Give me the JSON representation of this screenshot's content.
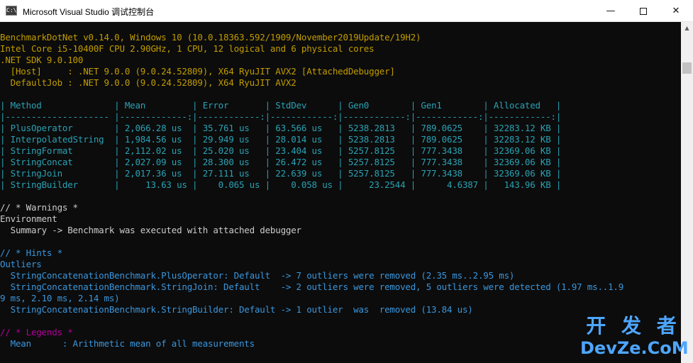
{
  "window": {
    "title": "Microsoft Visual Studio 调试控制台",
    "icon_text": "C:\\",
    "buttons": {
      "minimize": "—",
      "maximize": "",
      "close": "✕"
    }
  },
  "console": {
    "env_lines": [
      "BenchmarkDotNet v0.14.0, Windows 10 (10.0.18363.592/1909/November2019Update/19H2)",
      "Intel Core i5-10400F CPU 2.90GHz, 1 CPU, 12 logical and 6 physical cores",
      ".NET SDK 9.0.100",
      "  [Host]     : .NET 9.0.0 (9.0.24.52809), X64 RyuJIT AVX2 [AttachedDebugger]",
      "  DefaultJob : .NET 9.0.0 (9.0.24.52809), X64 RyuJIT AVX2"
    ],
    "table": {
      "headers": [
        "Method",
        "Mean",
        "Error",
        "StdDev",
        "Gen0",
        "Gen1",
        "Allocated"
      ],
      "header_line": "| Method              | Mean         | Error       | StdDev      | Gen0        | Gen1        | Allocated   |",
      "separator_line": "|-------------------- |-------------:|------------:|------------:|------------:|------------:|------------:|",
      "rows": [
        {
          "method": "PlusOperator",
          "mean": "2,066.28 us",
          "error": "35.761 us",
          "stddev": "63.566 us",
          "gen0": "5238.2813",
          "gen1": "789.0625",
          "allocated": "32283.12 KB"
        },
        {
          "method": "InterpolatedString",
          "mean": "1,984.56 us",
          "error": "29.949 us",
          "stddev": "28.014 us",
          "gen0": "5238.2813",
          "gen1": "789.0625",
          "allocated": "32283.12 KB"
        },
        {
          "method": "StringFormat",
          "mean": "2,112.02 us",
          "error": "25.020 us",
          "stddev": "23.404 us",
          "gen0": "5257.8125",
          "gen1": "777.3438",
          "allocated": "32369.06 KB"
        },
        {
          "method": "StringConcat",
          "mean": "2,027.09 us",
          "error": "28.300 us",
          "stddev": "26.472 us",
          "gen0": "5257.8125",
          "gen1": "777.3438",
          "allocated": "32369.06 KB"
        },
        {
          "method": "StringJoin",
          "mean": "2,017.36 us",
          "error": "27.111 us",
          "stddev": "22.639 us",
          "gen0": "5257.8125",
          "gen1": "777.3438",
          "allocated": "32369.06 KB"
        },
        {
          "method": "StringBuilder",
          "mean": "13.63 us",
          "error": "0.065 us",
          "stddev": "0.058 us",
          "gen0": "23.2544",
          "gen1": "4.6387",
          "allocated": "143.96 KB"
        }
      ],
      "row_lines": [
        "| PlusOperator        | 2,066.28 us  | 35.761 us   | 63.566 us   | 5238.2813   | 789.0625    | 32283.12 KB |",
        "| InterpolatedString  | 1,984.56 us  | 29.949 us   | 28.014 us   | 5238.2813   | 789.0625    | 32283.12 KB |",
        "| StringFormat        | 2,112.02 us  | 25.020 us   | 23.404 us   | 5257.8125   | 777.3438    | 32369.06 KB |",
        "| StringConcat        | 2,027.09 us  | 28.300 us   | 26.472 us   | 5257.8125   | 777.3438    | 32369.06 KB |",
        "| StringJoin          | 2,017.36 us  | 27.111 us   | 22.639 us   | 5257.8125   | 777.3438    | 32369.06 KB |",
        "| StringBuilder       |     13.63 us |    0.065 us |    0.058 us |     23.2544 |      4.6387 |   143.96 KB |"
      ]
    },
    "warnings": {
      "header": "// * Warnings *",
      "category": "Environment",
      "message": "  Summary -> Benchmark was executed with attached debugger"
    },
    "hints": {
      "header": "// * Hints *",
      "category": "Outliers",
      "lines": [
        "  StringConcatenationBenchmark.PlusOperator: Default  -> 7 outliers were removed (2.35 ms..2.95 ms)",
        "  StringConcatenationBenchmark.StringJoin: Default    -> 2 outliers were removed, 5 outliers were detected (1.97 ms..1.9",
        "9 ms, 2.10 ms, 2.14 ms)",
        "  StringConcatenationBenchmark.StringBuilder: Default -> 1 outlier  was  removed (13.84 us)"
      ]
    },
    "legends": {
      "header": "// * Legends *",
      "first_line": "  Mean      : Arithmetic mean of all measurements"
    }
  },
  "watermark": {
    "cn": "开 发 者",
    "en": "DevZe.CoM"
  },
  "colors": {
    "yellow": "#c19c00",
    "white": "#cccccc",
    "cyan": "#3a96dd",
    "teal": "#2aa1b3",
    "magenta": "#b4009e",
    "background": "#0c0c0c"
  }
}
